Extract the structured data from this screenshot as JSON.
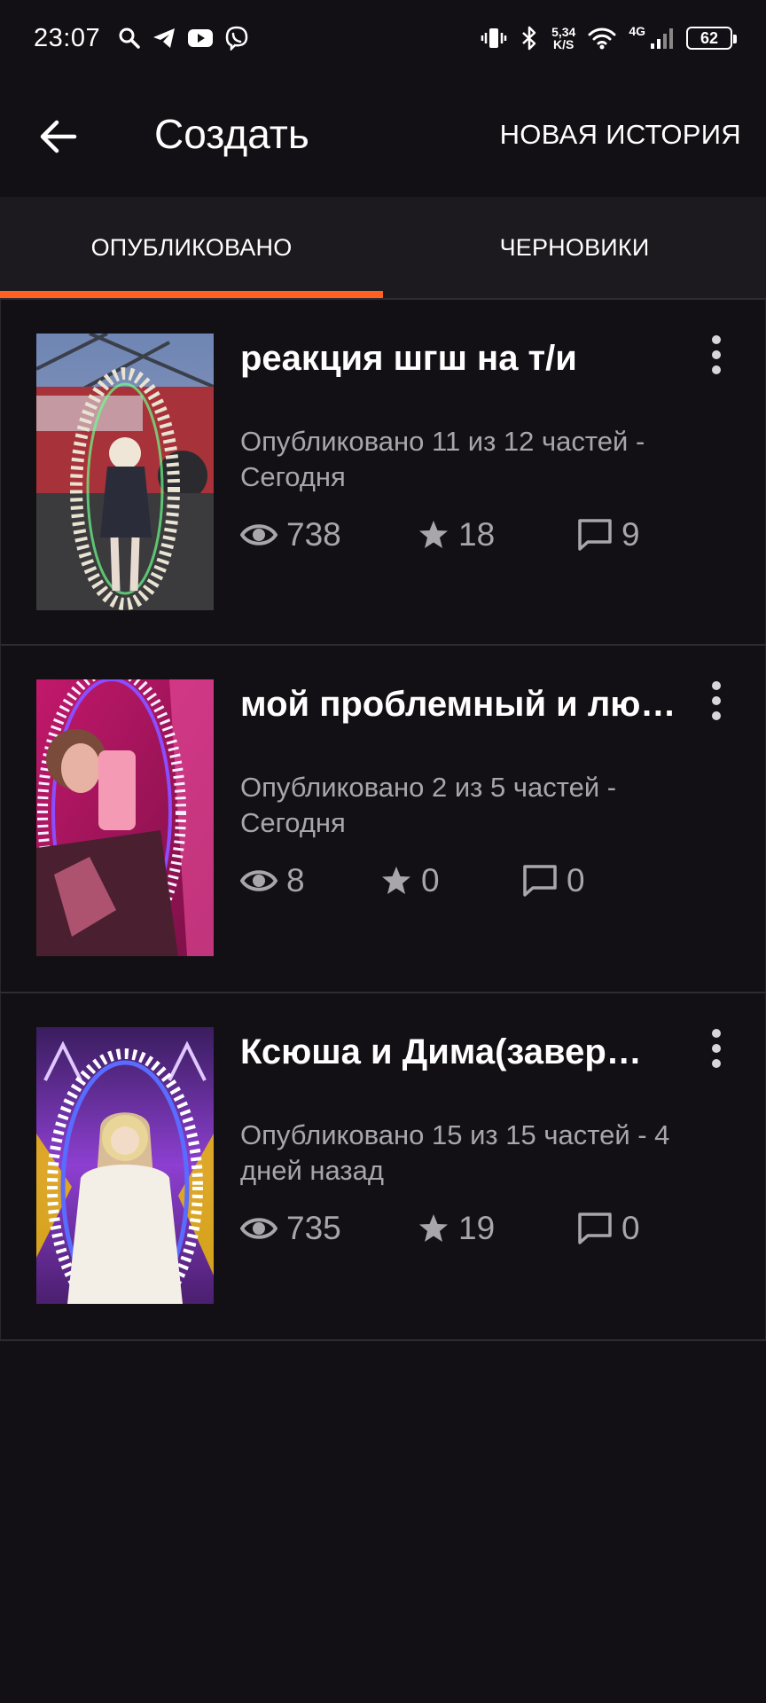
{
  "status_bar": {
    "time": "23:07",
    "left_icons": [
      "search-icon",
      "telegram-icon",
      "youtube-icon",
      "viber-icon"
    ],
    "speed_value": "5,34",
    "speed_unit": "K/S",
    "network": "4G",
    "battery": "62"
  },
  "appbar": {
    "title": "Создать",
    "new_story_label": "НОВАЯ ИСТОРИЯ"
  },
  "tabs": [
    {
      "label": "ОПУБЛИКОВАНО",
      "active": true
    },
    {
      "label": "ЧЕРНОВИКИ",
      "active": false
    }
  ],
  "stories": [
    {
      "title": "реакция шгш на т/и",
      "meta": "Опубликовано 11 из 12 частей - Сегодня",
      "views": "738",
      "votes": "18",
      "comments": "9"
    },
    {
      "title": "мой проблемный и лю…",
      "meta": "Опубликовано 2 из 5 частей - Сегодня",
      "views": "8",
      "votes": "0",
      "comments": "0"
    },
    {
      "title": "Ксюша и Дима(завер…",
      "meta": "Опубликовано 15 из 15 частей - 4 дней назад",
      "views": "735",
      "votes": "19",
      "comments": "0"
    }
  ],
  "colors": {
    "background": "#121014",
    "tab_bar": "#1c1a1e",
    "accent": "#ff6122",
    "secondary_text": "#a9a6ab"
  }
}
